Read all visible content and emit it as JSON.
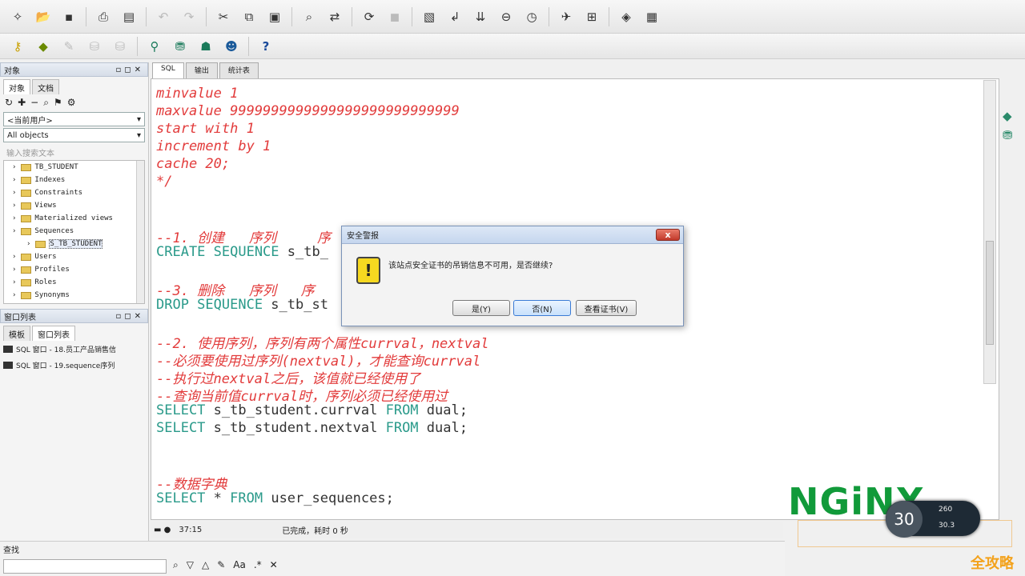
{
  "toolbar1": {
    "icons": [
      "new-icon",
      "open-icon",
      "save-icon",
      "print-icon",
      "print-preview-icon",
      "undo-icon",
      "redo-icon",
      "cut-icon",
      "copy-icon",
      "paste-icon",
      "find-icon",
      "replace-icon",
      "execute-icon",
      "stop-icon",
      "commit-icon",
      "rollback-icon",
      "explain-icon",
      "compile-icon",
      "window-icon",
      "layout-icon"
    ]
  },
  "toolbar2": {
    "help_label": "?"
  },
  "left_panel": {
    "header": "对象",
    "subtabs": [
      "对象",
      "文档"
    ],
    "user_combo": "<当前用户>",
    "objects_combo": "All objects",
    "search_placeholder": "输入搜索文本",
    "tree_items": [
      {
        "label": "TB_STUDENT",
        "child": false
      },
      {
        "label": "Indexes",
        "child": false
      },
      {
        "label": "Constraints",
        "child": false
      },
      {
        "label": "Views",
        "child": false
      },
      {
        "label": "Materialized views",
        "child": false
      },
      {
        "label": "Sequences",
        "child": false
      },
      {
        "label": "S_TB_STUDENT",
        "child": true
      },
      {
        "label": "Users",
        "child": false
      },
      {
        "label": "Profiles",
        "child": false
      },
      {
        "label": "Roles",
        "child": false
      },
      {
        "label": "Synonyms",
        "child": false
      }
    ],
    "window_list_header": "窗口列表",
    "window_list_tabs": [
      "模板",
      "窗口列表"
    ],
    "window_list_items": [
      "SQL 窗口 - 18.员工产品销售信",
      "SQL 窗口 - 19.sequence序列"
    ]
  },
  "editor": {
    "tabs": [
      "SQL",
      "输出",
      "统计表"
    ],
    "lines": [
      {
        "segments": [
          {
            "t": "minvalue 1",
            "c": "red"
          }
        ]
      },
      {
        "segments": [
          {
            "t": "maxvalue 9999999999999999999999999999",
            "c": "red"
          }
        ]
      },
      {
        "segments": [
          {
            "t": "start with 1",
            "c": "red"
          }
        ]
      },
      {
        "segments": [
          {
            "t": "increment by 1",
            "c": "red"
          }
        ]
      },
      {
        "segments": [
          {
            "t": "cache 20;",
            "c": "red"
          }
        ]
      },
      {
        "segments": [
          {
            "t": "*/",
            "c": "red"
          }
        ]
      },
      {
        "segments": []
      },
      {
        "segments": []
      },
      {
        "segments": [
          {
            "t": "--1. 创建   序列     序",
            "c": "red"
          }
        ]
      },
      {
        "segments": [
          {
            "t": "CREATE SEQUENCE",
            "c": "kw"
          },
          {
            "t": " s_tb_",
            "c": "tx"
          }
        ]
      },
      {
        "segments": []
      },
      {
        "segments": [
          {
            "t": "--3. 删除   序列   序",
            "c": "red"
          }
        ]
      },
      {
        "segments": [
          {
            "t": "DROP SEQUENCE",
            "c": "kw"
          },
          {
            "t": " s_tb_st",
            "c": "tx"
          }
        ]
      },
      {
        "segments": []
      },
      {
        "segments": [
          {
            "t": "--2. 使用序列，序列有两个属性currval，nextval",
            "c": "red"
          }
        ]
      },
      {
        "segments": [
          {
            "t": "--必须要使用过序列(nextval)，才能查询currval",
            "c": "red"
          }
        ]
      },
      {
        "segments": [
          {
            "t": "--执行过nextval之后，该值就已经使用了",
            "c": "red"
          }
        ]
      },
      {
        "segments": [
          {
            "t": "--查询当前值currval时，序列必须已经使用过",
            "c": "red"
          }
        ]
      },
      {
        "segments": [
          {
            "t": "SELECT",
            "c": "kw"
          },
          {
            "t": " s_tb_student.currval ",
            "c": "tx"
          },
          {
            "t": "FROM",
            "c": "kw"
          },
          {
            "t": " dual;",
            "c": "tx"
          }
        ]
      },
      {
        "segments": [
          {
            "t": "SELECT",
            "c": "kw"
          },
          {
            "t": " s_tb_student.nextval ",
            "c": "tx"
          },
          {
            "t": "FROM",
            "c": "kw"
          },
          {
            "t": " dual;",
            "c": "tx"
          }
        ]
      },
      {
        "segments": []
      },
      {
        "segments": []
      },
      {
        "segments": [
          {
            "t": "--数据字典",
            "c": "red"
          }
        ]
      },
      {
        "segments": [
          {
            "t": "SELECT",
            "c": "kw"
          },
          {
            "t": " * ",
            "c": "tx"
          },
          {
            "t": "FROM",
            "c": "kw"
          },
          {
            "t": " user_sequences;",
            "c": "tx"
          }
        ]
      }
    ]
  },
  "status": {
    "position": "37:15",
    "message": "已完成，耗时 0 秒"
  },
  "find": {
    "label": "查找"
  },
  "dialog": {
    "title": "安全警报",
    "message": "该站点安全证书的吊销信息不可用，是否继续?",
    "buttons": [
      "是(Y)",
      "否(N)",
      "查看证书(V)"
    ],
    "close": "x"
  },
  "overlay": {
    "brand": "NGiNX",
    "speed_value": "30",
    "speed_up": "260",
    "speed_down": "30.3",
    "watermark": "全攻略"
  },
  "colors": {
    "comment": "#e23b3b",
    "keyword": "#2a9a8a",
    "nginx": "#119a3a",
    "watermark": "#f3a21c"
  }
}
